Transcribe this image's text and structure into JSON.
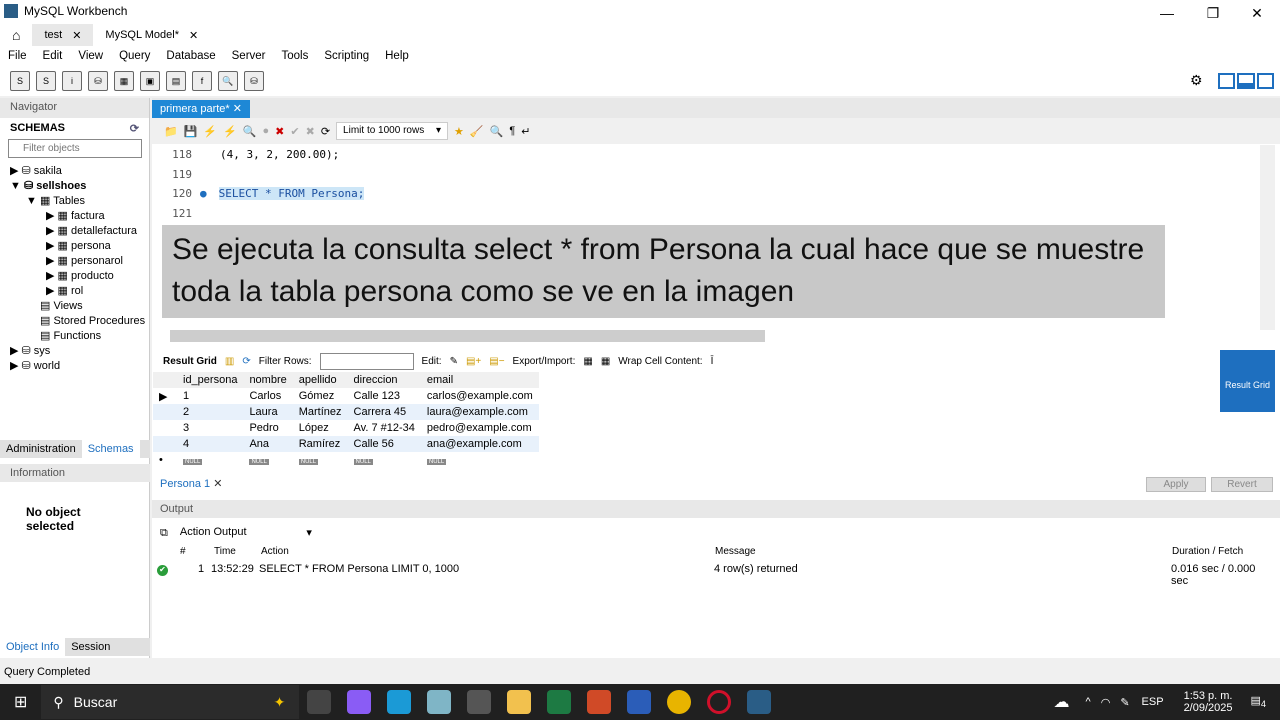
{
  "window": {
    "title": "MySQL Workbench",
    "minimize": "—",
    "restore": "❐",
    "close": "✕"
  },
  "tabs": [
    {
      "label": "test"
    },
    {
      "label": "MySQL Model*"
    }
  ],
  "menu": [
    "File",
    "Edit",
    "View",
    "Query",
    "Database",
    "Server",
    "Tools",
    "Scripting",
    "Help"
  ],
  "navigator": {
    "title": "Navigator",
    "schemas_label": "SCHEMAS",
    "filter_placeholder": "Filter objects",
    "tree": [
      "sakila",
      "sellshoes",
      "Tables",
      "factura",
      "detallefactura",
      "persona",
      "personarol",
      "producto",
      "rol",
      "Views",
      "Stored Procedures",
      "Functions",
      "sys",
      "world"
    ],
    "bottom_tabs": [
      "Administration",
      "Schemas"
    ],
    "info_title": "Information",
    "no_object": "No object selected",
    "info_tabs": [
      "Object Info",
      "Session"
    ]
  },
  "editor": {
    "tab": "primera parte*",
    "limit": "Limit to 1000 rows",
    "lines": [
      {
        "n": "118",
        "code": "(4, 3, 2, 200.00);"
      },
      {
        "n": "119",
        "code": ""
      },
      {
        "n": "120",
        "code": "SELECT * FROM Persona;"
      },
      {
        "n": "121",
        "code": ""
      }
    ]
  },
  "caption": "Se ejecuta la consulta select * from Persona la cual hace que se muestre toda la tabla persona como se ve en la imagen",
  "result": {
    "result_grid": "Result Grid",
    "filter_rows": "Filter Rows:",
    "edit": "Edit:",
    "export": "Export/Import:",
    "wrap": "Wrap Cell Content:",
    "side_label": "Result Grid",
    "columns": [
      "id_persona",
      "nombre",
      "apellido",
      "direccion",
      "email"
    ],
    "rows": [
      [
        "1",
        "Carlos",
        "Gómez",
        "Calle 123",
        "carlos@example.com"
      ],
      [
        "2",
        "Laura",
        "Martínez",
        "Carrera 45",
        "laura@example.com"
      ],
      [
        "3",
        "Pedro",
        "López",
        "Av. 7 #12-34",
        "pedro@example.com"
      ],
      [
        "4",
        "Ana",
        "Ramírez",
        "Calle 56",
        "ana@example.com"
      ]
    ],
    "null": "NULL",
    "tab": "Persona 1",
    "apply": "Apply",
    "revert": "Revert"
  },
  "output": {
    "title": "Output",
    "selector": "Action Output",
    "headers": [
      "#",
      "Time",
      "Action",
      "Message",
      "Duration / Fetch"
    ],
    "row": {
      "n": "1",
      "time": "13:52:29",
      "action": "SELECT * FROM Persona LIMIT 0, 1000",
      "message": "4 row(s) returned",
      "duration": "0.016 sec / 0.000 sec"
    }
  },
  "status": "Query Completed",
  "taskbar": {
    "search": "Buscar",
    "lang": "ESP",
    "time": "1:53 p. m.",
    "date": "2/09/2025",
    "notif": "4"
  }
}
